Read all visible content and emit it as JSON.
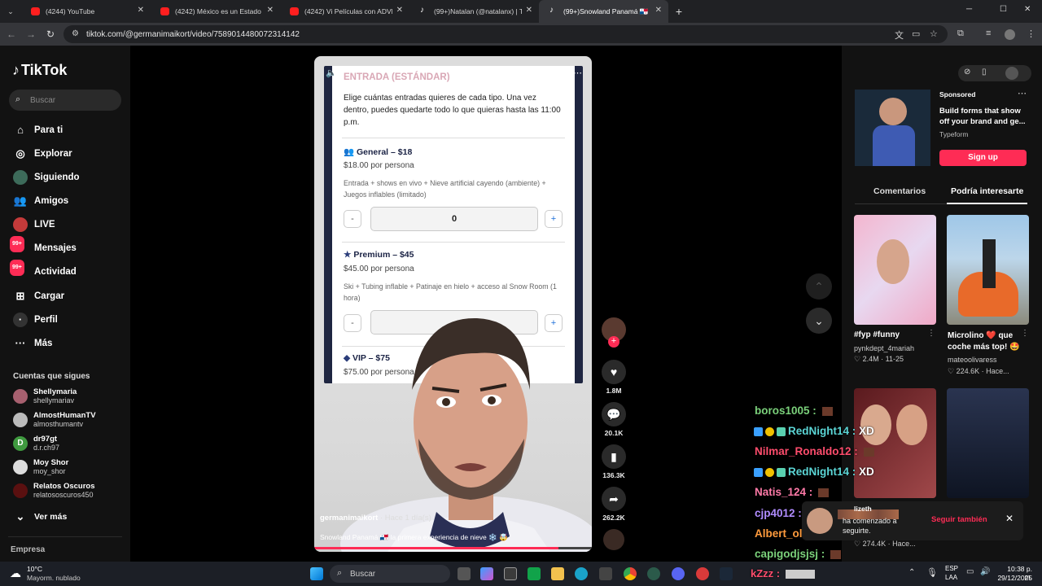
{
  "browser": {
    "tabs": [
      {
        "title": "(4244) YouTube",
        "icon": "youtube-icon"
      },
      {
        "title": "(4242) México es un Estado Fallid",
        "icon": "youtube-icon"
      },
      {
        "title": "(4242) Vi Películas con ADVERTI",
        "icon": "youtube-icon"
      },
      {
        "title": "(99+)Natalan (@natalanx) | TikT",
        "icon": "tiktok-icon"
      },
      {
        "title": "(99+)Snowland Panamá 🇵🇦",
        "icon": "tiktok-icon"
      }
    ],
    "url": "tiktok.com/@germanimaikort/video/7589014480072314142"
  },
  "sidebar": {
    "logo": "TikTok",
    "search_placeholder": "Buscar",
    "nav": [
      {
        "label": "Para ti",
        "icon": "home-icon"
      },
      {
        "label": "Explorar",
        "icon": "compass-icon"
      },
      {
        "label": "Siguiendo",
        "icon": "following-icon"
      },
      {
        "label": "Amigos",
        "icon": "friends-icon"
      },
      {
        "label": "LIVE",
        "icon": "live-icon"
      },
      {
        "label": "Mensajes",
        "icon": "messages-icon",
        "badge": "99+"
      },
      {
        "label": "Actividad",
        "icon": "activity-icon",
        "badge": "99+"
      },
      {
        "label": "Cargar",
        "icon": "upload-icon"
      },
      {
        "label": "Perfil",
        "icon": "profile-icon"
      },
      {
        "label": "Más",
        "icon": "more-icon"
      }
    ],
    "following_title": "Cuentas que sigues",
    "following": [
      {
        "name": "Shellymaria",
        "handle": "shellymariav"
      },
      {
        "name": "AlmostHumanTV",
        "handle": "almosthumantv"
      },
      {
        "name": "dr97gt",
        "handle": "d.r.ch97",
        "initial": "D"
      },
      {
        "name": "Moy Shor",
        "handle": "moy_shor"
      },
      {
        "name": "Relatos Oscuros",
        "handle": "relatososcuros450"
      }
    ],
    "see_more": "Ver más",
    "footer": "Empresa"
  },
  "video": {
    "doc": {
      "heading": "ENTRADA (ESTÁNDAR)",
      "intro": "Elige cuántas entradas quieres de cada tipo. Una vez dentro, puedes quedarte todo lo que quieras hasta las 11:00 p.m.",
      "tickets": [
        {
          "name": "General – $18",
          "price": "$18.00 por persona",
          "desc": "Entrada + shows en vivo + Nieve artificial cayendo (ambiente) + Juegos inflables (limitado)",
          "qty": "0"
        },
        {
          "name": "Premium – $45",
          "price": "$45.00 por persona",
          "desc": "Ski + Tubing inflable + Patinaje en hielo + acceso al Snow Room (1 hora)",
          "qty": ""
        },
        {
          "name": "VIP – $75",
          "price": "$75.00 por persona"
        }
      ],
      "minus": "-",
      "plus": "+"
    },
    "author": "germanimaikort",
    "time": "· Hace 1 día(s)",
    "description": "Snowland Panamá 🇵🇦 la primera experiencia de nieve ❄️ 🤯",
    "progress": 0.88
  },
  "actions": {
    "likes": "1.8M",
    "comments": "20.1K",
    "saves": "136.3K",
    "shares": "262.2K"
  },
  "ad": {
    "sponsored": "Sponsored",
    "text": "Build forms that show off your brand and ge...",
    "brand": "Typeform",
    "cta": "Sign up"
  },
  "right_tabs": {
    "comments": "Comentarios",
    "related": "Podría interesarte"
  },
  "related": [
    {
      "caption": "#fyp #funny",
      "user": "pynkdept_4mariah",
      "likes": "2.4M",
      "date": "11-25"
    },
    {
      "caption": "Microlino ❤️ que coche más top! 🤩",
      "user": "mateoolivaress",
      "likes": "224.6K",
      "date": "Hace..."
    },
    {
      "caption": "",
      "user": "",
      "likes": "274.4K",
      "date": "Hace..."
    }
  ],
  "chat": [
    {
      "user": "boros1005",
      "color": "#7bd17b"
    },
    {
      "user": "RedNight14",
      "msg": "XD",
      "color": "#5bd5d5"
    },
    {
      "user": "Nilmar_Ronaldo12",
      "color": "#ff4d6d"
    },
    {
      "user": "RedNight14",
      "msg": "XD",
      "color": "#5bd5d5"
    },
    {
      "user": "Natis_124",
      "color": "#ff7aa8"
    },
    {
      "user": "cjp4012",
      "color": "#b08cff"
    },
    {
      "user": "Albert_ol7_7",
      "color": "#ff9b3d"
    },
    {
      "user": "capigodjsjsj",
      "color": "#7bd17b"
    },
    {
      "user": "kZzz",
      "color": "#ff4d6d"
    }
  ],
  "toast": {
    "name": "lizeth",
    "text": "ha comenzado a seguirte.",
    "action": "Seguir también"
  },
  "taskbar": {
    "weather_temp": "10°C",
    "weather_desc": "Mayorm. nublado",
    "search": "Buscar",
    "lang": "ESP",
    "lang2": "LAA",
    "time": "10:38 p. m.",
    "date": "29/12/2025"
  }
}
